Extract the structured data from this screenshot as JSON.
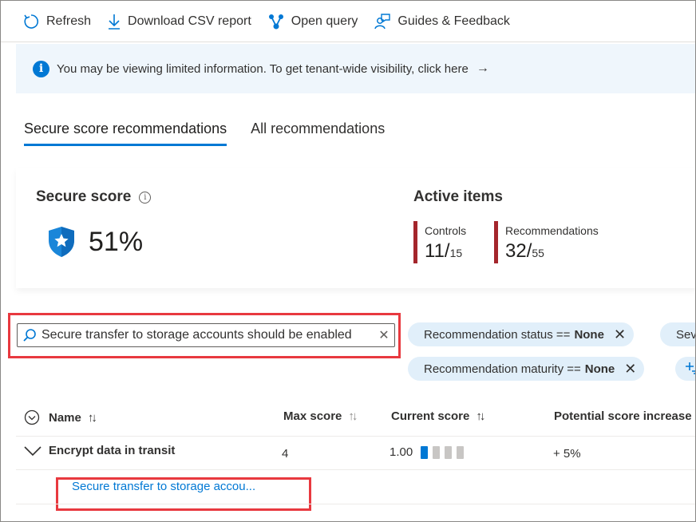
{
  "toolbar": {
    "refresh": "Refresh",
    "download": "Download CSV report",
    "open_query": "Open query",
    "guides": "Guides & Feedback"
  },
  "banner": {
    "text": "You may be viewing limited information. To get tenant-wide visibility, click here",
    "arrow": "→"
  },
  "tabs": [
    {
      "label": "Secure score recommendations",
      "active": true
    },
    {
      "label": "All recommendations",
      "active": false
    }
  ],
  "secure_score": {
    "title": "Secure score",
    "value": "51%"
  },
  "active_items": {
    "title": "Active items",
    "controls": {
      "label": "Controls",
      "value": "11/",
      "total": "15"
    },
    "recommendations": {
      "label": "Recommendations",
      "value": "32/",
      "total": "55"
    }
  },
  "search": {
    "value": "Secure transfer to storage accounts should be enabled",
    "clear": "✕"
  },
  "filters": [
    {
      "key": "Recommendation status ==",
      "value": "None"
    },
    {
      "key": "Sev",
      "value": ""
    },
    {
      "key": "Recommendation maturity ==",
      "value": "None"
    }
  ],
  "table": {
    "headers": {
      "name": "Name",
      "max_score": "Max score",
      "current_score": "Current score",
      "potential": "Potential score increase"
    },
    "row": {
      "name": "Encrypt data in transit",
      "max_score": "4",
      "current_score": "1.00",
      "current_score_fraction": 0.25,
      "potential": "+ 5%"
    },
    "sub_row": {
      "name": "Secure transfer to storage accou..."
    }
  },
  "colors": {
    "accent": "#0078d4",
    "metric_bar": "#a4262c",
    "highlight": "#e8393f",
    "pill_bg": "#e1effa",
    "banner_bg": "#eff6fc"
  }
}
